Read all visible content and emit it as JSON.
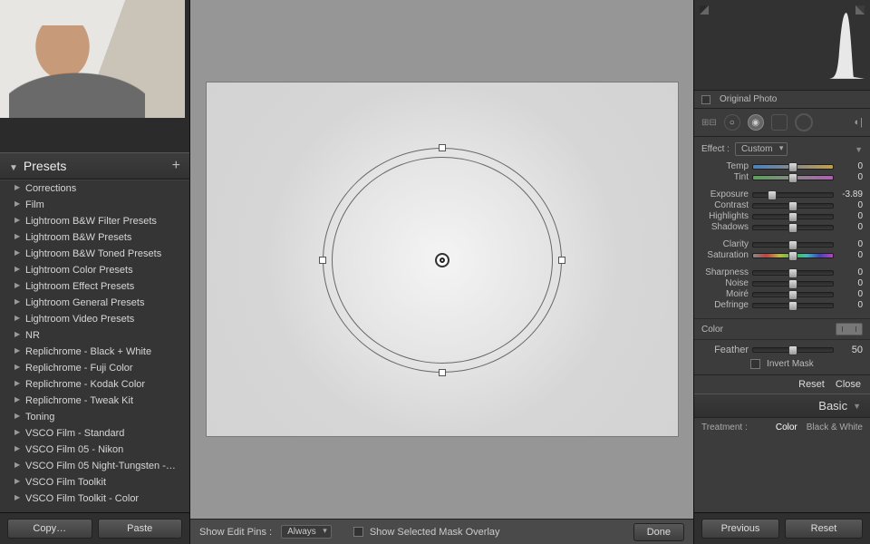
{
  "left": {
    "presets_title": "Presets",
    "items": [
      "Corrections",
      "Film",
      "Lightroom B&W Filter Presets",
      "Lightroom B&W Presets",
      "Lightroom B&W Toned Presets",
      "Lightroom Color Presets",
      "Lightroom Effect Presets",
      "Lightroom General Presets",
      "Lightroom Video Presets",
      "NR",
      "Replichrome - Black + White",
      "Replichrome - Fuji Color",
      "Replichrome - Kodak Color",
      "Replichrome - Tweak Kit",
      "Toning",
      "VSCO Film - Standard",
      "VSCO Film 05 - Nikon",
      "VSCO Film 05 Night-Tungsten -…",
      "VSCO Film Toolkit",
      "VSCO Film Toolkit - Color"
    ],
    "copy": "Copy…",
    "paste": "Paste"
  },
  "center": {
    "show_edit_pins_label": "Show Edit Pins :",
    "show_edit_pins_value": "Always",
    "show_mask_label": "Show Selected Mask Overlay",
    "done": "Done"
  },
  "right": {
    "original_photo": "Original Photo",
    "effect_label": "Effect :",
    "effect_value": "Custom",
    "sliders": {
      "temp": {
        "label": "Temp",
        "value": "0",
        "pos": 50
      },
      "tint": {
        "label": "Tint",
        "value": "0",
        "pos": 50
      },
      "exposure": {
        "label": "Exposure",
        "value": "-3.89",
        "pos": 24
      },
      "contrast": {
        "label": "Contrast",
        "value": "0",
        "pos": 50
      },
      "highlights": {
        "label": "Highlights",
        "value": "0",
        "pos": 50
      },
      "shadows": {
        "label": "Shadows",
        "value": "0",
        "pos": 50
      },
      "clarity": {
        "label": "Clarity",
        "value": "0",
        "pos": 50
      },
      "saturation": {
        "label": "Saturation",
        "value": "0",
        "pos": 50
      },
      "sharpness": {
        "label": "Sharpness",
        "value": "0",
        "pos": 50
      },
      "noise": {
        "label": "Noise",
        "value": "0",
        "pos": 50
      },
      "moire": {
        "label": "Moiré",
        "value": "0",
        "pos": 50
      },
      "defringe": {
        "label": "Defringe",
        "value": "0",
        "pos": 50
      }
    },
    "color_label": "Color",
    "feather": {
      "label": "Feather",
      "value": "50",
      "pos": 50
    },
    "invert_label": "Invert Mask",
    "reset": "Reset",
    "close": "Close",
    "basic": "Basic",
    "treatment_label": "Treatment :",
    "treatment_color": "Color",
    "treatment_bw": "Black & White",
    "previous": "Previous",
    "reset2": "Reset"
  }
}
